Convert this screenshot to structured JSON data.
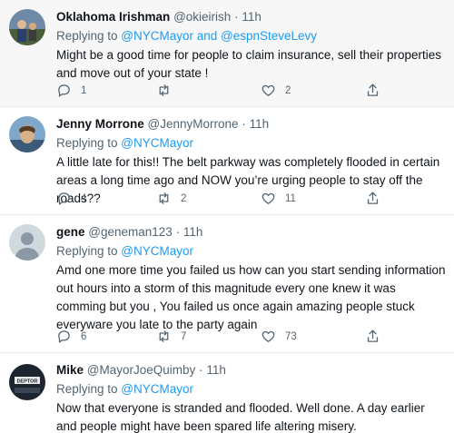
{
  "tweets": [
    {
      "name": "Oklahoma Irishman",
      "handle": "@okieirish",
      "dot": "·",
      "time": "11h",
      "reply_prefix": "Replying to ",
      "reply_targets": "@NYCMayor and @espnSteveLevy",
      "text": "Might be a good time for people to claim insurance, sell their properties and move out of your state !",
      "replies": "1",
      "retweets": "",
      "likes": "2"
    },
    {
      "name": "Jenny Morrone",
      "handle": "@JennyMorrone",
      "dot": "·",
      "time": "11h",
      "reply_prefix": "Replying to ",
      "reply_targets": "@NYCMayor",
      "text": "A little late for this!! The belt parkway was completely flooded in certain areas a long time ago and NOW you’re urging people to stay off the roads??",
      "replies": "4",
      "retweets": "2",
      "likes": "11"
    },
    {
      "name": "gene",
      "handle": "@geneman123",
      "dot": "·",
      "time": "11h",
      "reply_prefix": "Replying to ",
      "reply_targets": "@NYCMayor",
      "text": "Amd one more time you failed us how can you start sending information out hours into a storm of this magnitude every one knew it was comming but you ,  You failed us once again amazing people stuck everyware you late to the party again",
      "replies": "6",
      "retweets": "7",
      "likes": "73"
    },
    {
      "name": "Mike",
      "handle": "@MayorJoeQuimby",
      "dot": "·",
      "time": "11h",
      "reply_prefix": "Replying to ",
      "reply_targets": "@NYCMayor",
      "text": "Now that everyone is stranded and flooded.  Well done.  A day earlier and people might have been spared life altering misery.",
      "avatar_text": "DEPTOR"
    }
  ],
  "colors": {
    "link": "#1d9bf0",
    "secondary_text": "#536471",
    "shaded_background": "#f7f7f7"
  },
  "icons": [
    "reply-icon",
    "retweet-icon",
    "like-icon",
    "share-icon"
  ]
}
